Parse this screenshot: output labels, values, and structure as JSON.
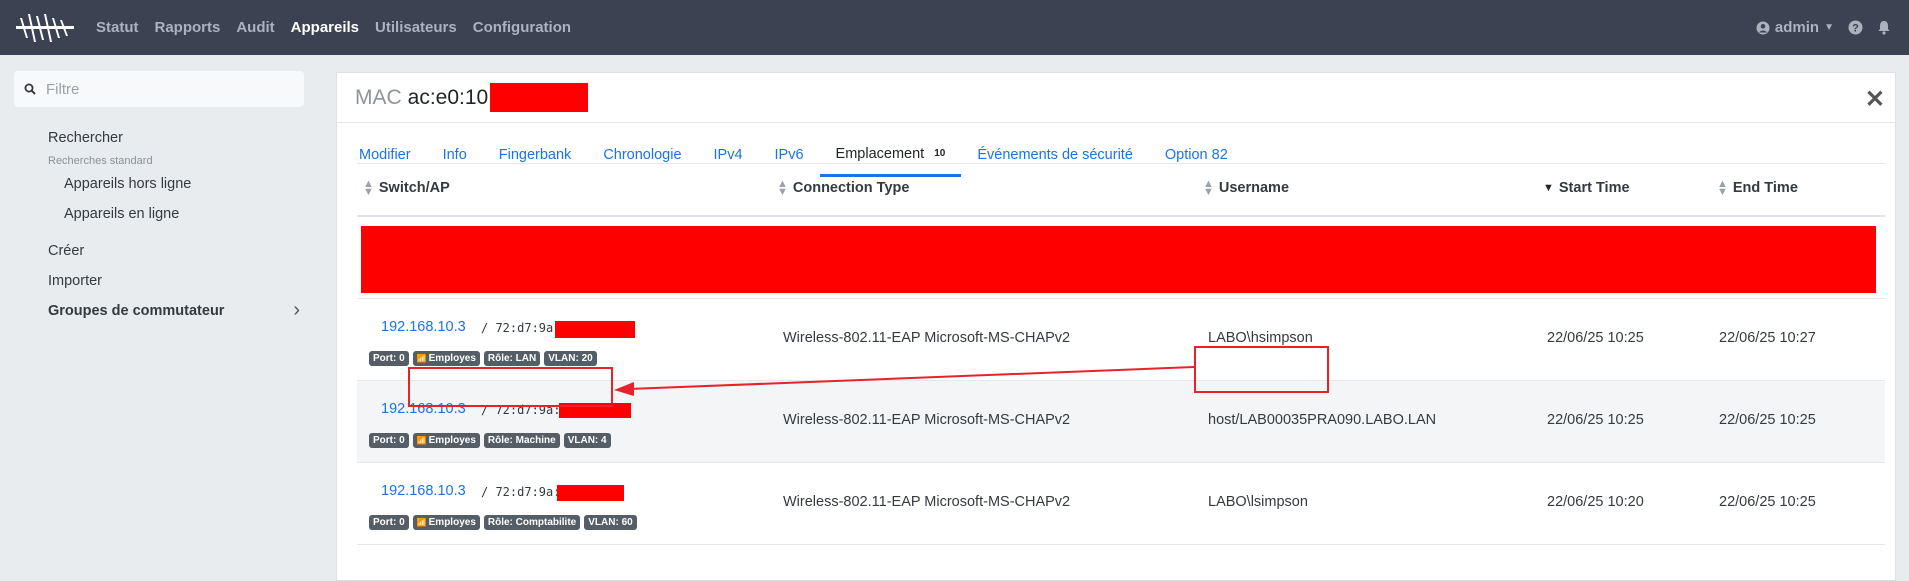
{
  "navbar": {
    "items": [
      {
        "label": "Statut",
        "active": false
      },
      {
        "label": "Rapports",
        "active": false
      },
      {
        "label": "Audit",
        "active": false
      },
      {
        "label": "Appareils",
        "active": true
      },
      {
        "label": "Utilisateurs",
        "active": false
      },
      {
        "label": "Configuration",
        "active": false
      }
    ],
    "user": "admin",
    "help_icon": "question-circle-icon",
    "bell_icon": "bell-icon"
  },
  "sidebar": {
    "filter_placeholder": "Filtre",
    "search": "Rechercher",
    "standard_searches": "Recherches standard",
    "offline": "Appareils hors ligne",
    "online": "Appareils en ligne",
    "create": "Créer",
    "import": "Importer",
    "switch_groups": "Groupes de commutateur"
  },
  "panel": {
    "mac_prefix": "MAC",
    "mac_value": "ac:e0:10",
    "close": "✕",
    "tabs": [
      {
        "label": "Modifier"
      },
      {
        "label": "Info"
      },
      {
        "label": "Fingerbank"
      },
      {
        "label": "Chronologie"
      },
      {
        "label": "IPv4"
      },
      {
        "label": "IPv6"
      },
      {
        "label": "Emplacement",
        "count": "10",
        "active": true
      },
      {
        "label": "Événements de sécurité"
      },
      {
        "label": "Option 82"
      }
    ]
  },
  "table": {
    "headers": {
      "switch": "Switch/AP",
      "conn": "Connection Type",
      "user": "Username",
      "start": "Start Time",
      "end": "End Time"
    },
    "rows": [
      {
        "ip": "192.168.10.3",
        "mac": "/ 72:d7:9a",
        "port": "Port: 0",
        "ssid": "Employes",
        "role": "Rôle: LAN",
        "vlan": "VLAN: 20",
        "conn": "Wireless-802.11-EAP Microsoft-MS-CHAPv2",
        "user": "LABO\\hsimpson",
        "start": "22/06/25 10:25",
        "end": "22/06/25 10:27"
      },
      {
        "ip": "192.168.10.3",
        "mac": "/ 72:d7:9a:",
        "port": "Port: 0",
        "ssid": "Employes",
        "role": "Rôle: Machine",
        "vlan": "VLAN: 4",
        "conn": "Wireless-802.11-EAP Microsoft-MS-CHAPv2",
        "user": "host/LAB00035PRA090.LABO.LAN",
        "start": "22/06/25 10:25",
        "end": "22/06/25 10:25"
      },
      {
        "ip": "192.168.10.3",
        "mac": "/ 72:d7:9a:",
        "port": "Port: 0",
        "ssid": "Employes",
        "role": "Rôle: Comptabilite",
        "vlan": "VLAN: 60",
        "conn": "Wireless-802.11-EAP Microsoft-MS-CHAPv2",
        "user": "LABO\\lsimpson",
        "start": "22/06/25 10:20",
        "end": "22/06/25 10:25"
      }
    ]
  },
  "colors": {
    "navbar_bg": "#3b4252",
    "accent": "#1a73e8",
    "redaction": "#ff0000",
    "annotation": "#e8222a"
  }
}
